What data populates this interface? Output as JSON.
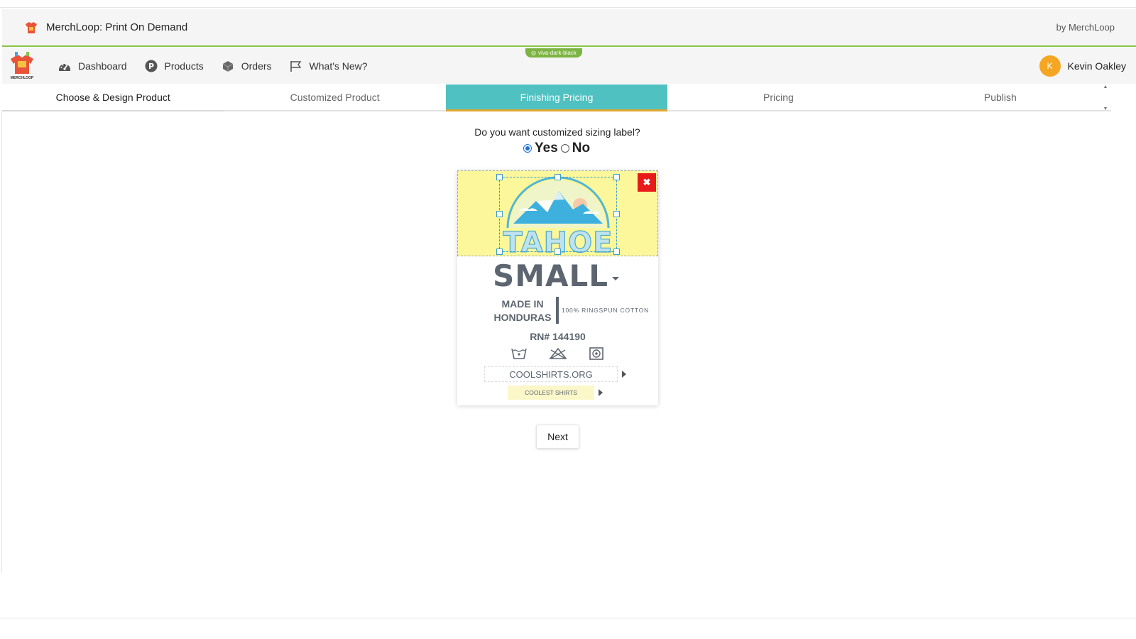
{
  "app": {
    "title": "MerchLoop: Print On Demand",
    "by": "by MerchLoop",
    "logo_text": "MERCHLOOP"
  },
  "nav": {
    "items": [
      {
        "label": "Dashboard",
        "icon": "dashboard-gauge-icon"
      },
      {
        "label": "Products",
        "icon": "products-p-icon"
      },
      {
        "label": "Orders",
        "icon": "orders-box-icon"
      },
      {
        "label": "What's New?",
        "icon": "flag-icon"
      }
    ],
    "theme_badge": "viva-dark-black",
    "user": {
      "initial": "K",
      "name": "Kevin Oakley"
    }
  },
  "tabs": [
    {
      "label": "Choose & Design Product"
    },
    {
      "label": "Customized Product"
    },
    {
      "label": "Finishing Pricing",
      "active": true
    },
    {
      "label": "Pricing"
    },
    {
      "label": "Publish"
    }
  ],
  "form": {
    "question": "Do you want customized sizing label?",
    "options": [
      {
        "label": "Yes",
        "checked": true
      },
      {
        "label": "No",
        "checked": false
      }
    ],
    "next_label": "Next"
  },
  "label": {
    "art_text": "TAHOE",
    "size": "SMALL",
    "made_in": "MADE IN HONDURAS",
    "material": "100% RINGSPUN COTTON",
    "rn": "RN# 144190",
    "care_icons": [
      "wash-tub-icon",
      "no-bleach-triangle-icon",
      "tumble-dry-icon"
    ],
    "website": "COOLSHIRTS.ORG",
    "brand": "COOLEST SHIRTS",
    "delete_icon": "close-icon"
  },
  "colors": {
    "accent_green": "#8bc34a",
    "tab_active": "#4fc1c1",
    "tab_active_underline": "#e0a72f",
    "label_art_bg": "#fbf79a",
    "label_text": "#5d6670",
    "delete_red": "#e81b1b",
    "avatar": "#f5a623"
  }
}
